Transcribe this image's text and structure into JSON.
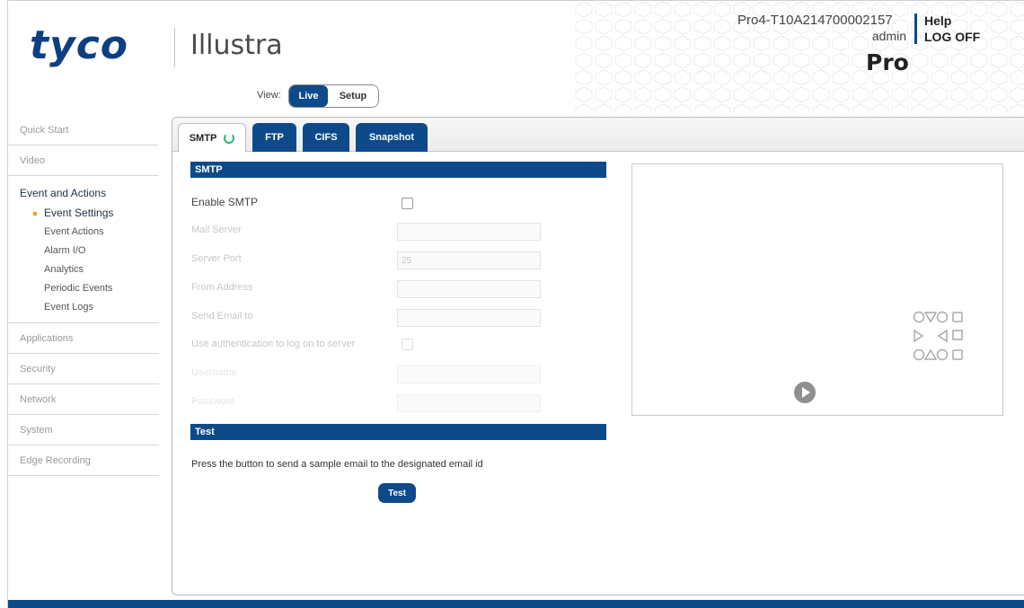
{
  "header": {
    "brand": "tyco",
    "product": "Illustra",
    "device_id": "Pro4-T10A214700002157",
    "user": "admin",
    "help": "Help",
    "logoff": "LOG OFF",
    "model": "Pro",
    "view_label": "View:",
    "view_live": "Live",
    "view_setup": "Setup"
  },
  "sidebar": {
    "top_items": [
      "Quick Start",
      "Video"
    ],
    "group_title": "Event and Actions",
    "sub_items": [
      "Event Settings",
      "Event Actions",
      "Alarm I/O",
      "Analytics",
      "Periodic Events",
      "Event Logs"
    ],
    "bottom_items": [
      "Applications",
      "Security",
      "Network",
      "System",
      "Edge Recording"
    ]
  },
  "tabs": [
    "SMTP",
    "FTP",
    "CIFS",
    "Snapshot"
  ],
  "smtp": {
    "section_title": "SMTP",
    "enable_label": "Enable SMTP",
    "mail_server_label": "Mail Server",
    "server_port_label": "Server Port",
    "server_port_value": "25",
    "from_address_label": "From Address",
    "send_email_label": "Send Email to",
    "use_auth_label": "Use authentication to log on to server",
    "username_label": "Username",
    "password_label": "Password"
  },
  "test": {
    "section_title": "Test",
    "description": "Press the button to send a sample email to the designated email id",
    "button": "Test"
  },
  "colors": {
    "brand_blue": "#0e4a8a",
    "refresh_green": "#2bb673",
    "active_bullet": "#f29b1d"
  }
}
